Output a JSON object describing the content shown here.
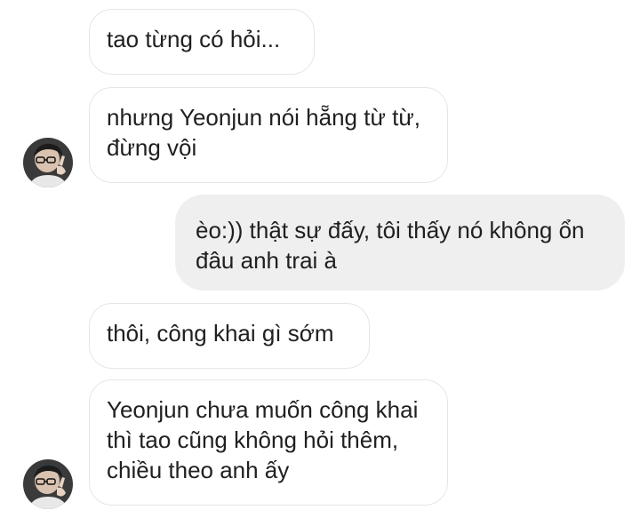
{
  "chat": {
    "messages": [
      {
        "direction": "received",
        "text": "tao từng có hỏi..."
      },
      {
        "direction": "received",
        "text": "nhưng Yeonjun nói hẵng từ từ, đừng vội"
      },
      {
        "direction": "sent",
        "text": "èo:)) thật sự đấy, tôi thấy nó không ổn đâu anh trai à"
      },
      {
        "direction": "received",
        "text": "thôi, công khai gì sớm"
      },
      {
        "direction": "received",
        "text": "Yeonjun chưa muốn công khai thì tao cũng không hỏi thêm, chiều theo anh ấy"
      }
    ]
  },
  "colors": {
    "received_bubble_border": "#e6e6e6",
    "sent_bubble_bg": "#efefef",
    "text": "#202020"
  },
  "icons": {
    "avatar": "contact-avatar-photo"
  }
}
